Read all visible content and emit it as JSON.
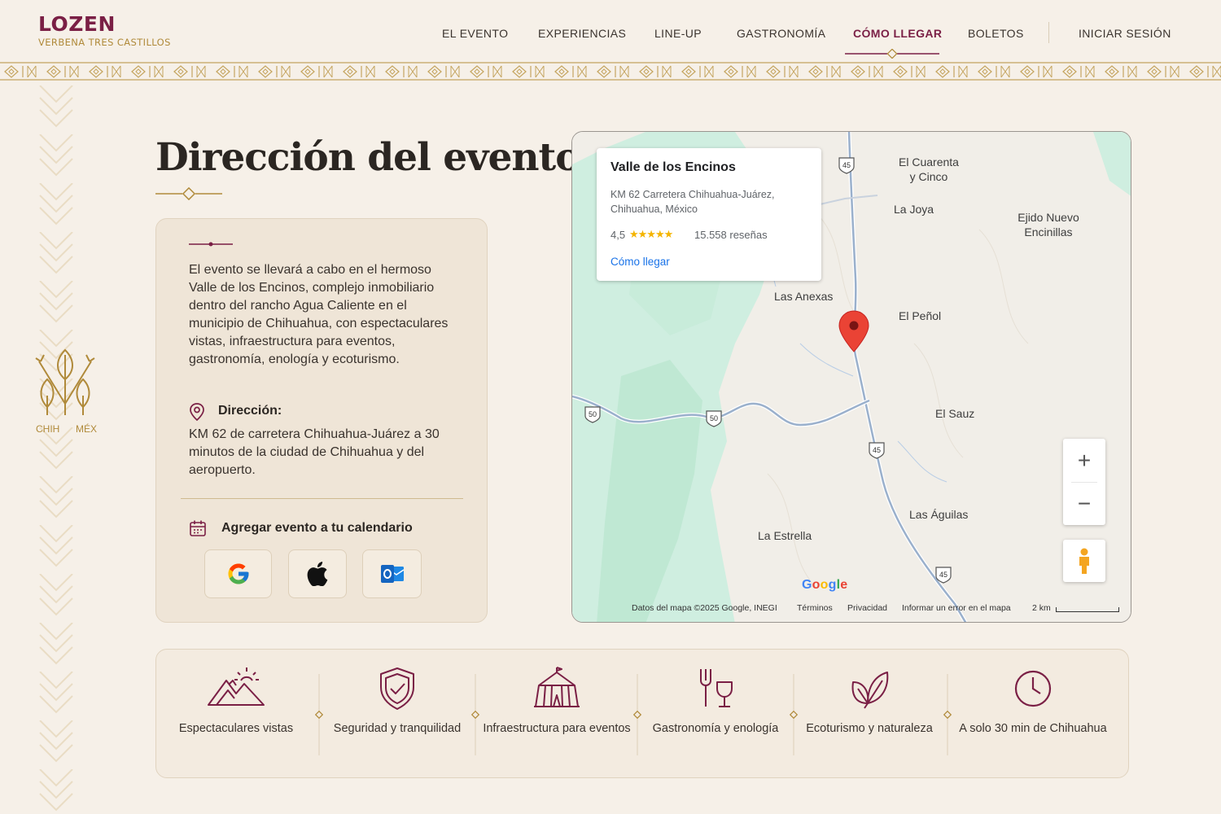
{
  "brand": {
    "name": "LOZEN",
    "tagline": "VERBENA TRES CASTILLOS",
    "primary_color": "#7a1f45",
    "gold_color": "#b08a3a"
  },
  "nav": {
    "items": [
      {
        "label": "EL EVENTO"
      },
      {
        "label": "EXPERIENCIAS"
      },
      {
        "label": "LINE-UP"
      },
      {
        "label": "GASTRONOMÍA"
      },
      {
        "label": "CÓMO LLEGAR",
        "active": true
      },
      {
        "label": "BOLETOS"
      }
    ],
    "login": "INICIAR SESIÓN"
  },
  "emblem": {
    "left": "CHIH",
    "right": "MÉX"
  },
  "page": {
    "title": "Dirección del evento"
  },
  "info": {
    "description": "El evento se llevará a cabo en el hermoso Valle de los Encinos, complejo inmobiliario dentro del rancho Agua Caliente en el municipio de Chihuahua, con espectaculares vistas, infraestructura para eventos, gastronomía, enología y ecoturismo.",
    "address_label": "Dirección:",
    "address_text": "KM 62 de carretera Chihuahua-Juárez a 30 minutos de la ciudad de Chihuahua y del aeropuerto.",
    "calendar_label": "Agregar evento a tu calendario",
    "calendar_buttons": [
      "google-calendar",
      "apple-calendar",
      "outlook-calendar"
    ]
  },
  "map": {
    "place": {
      "name": "Valle de los Encinos",
      "address": "KM 62 Carretera Chihuahua-Juárez, Chihuahua, México",
      "rating": "4,5",
      "stars": "★★★★★",
      "reviews": "15.558 reseñas",
      "directions": "Cómo llegar"
    },
    "labels": {
      "cuarenta": "El Cuarenta y Cinco",
      "joya": "La Joya",
      "ejido": "Ejido Nuevo Encinillas",
      "anexas": "Las Anexas",
      "penol": "El Peñol",
      "sauz": "El Sauz",
      "aguilas": "Las Águilas",
      "estrella": "La Estrella"
    },
    "route_45": "45",
    "route_50": "50",
    "zoom_in": "+",
    "zoom_out": "−",
    "google": "Google",
    "footer": {
      "data": "Datos del mapa ©2025 Google, INEGI",
      "terms": "Términos",
      "privacy": "Privacidad",
      "report": "Informar un error en el mapa",
      "scale": "2 km"
    }
  },
  "features": [
    {
      "label": "Espectaculares vistas",
      "icon": "mountains-icon"
    },
    {
      "label": "Seguridad y tranquilidad",
      "icon": "shield-check-icon"
    },
    {
      "label": "Infraestructura para eventos",
      "icon": "tent-icon"
    },
    {
      "label": "Gastronomía y enología",
      "icon": "fork-wine-icon"
    },
    {
      "label": "Ecoturismo y naturaleza",
      "icon": "leaf-icon"
    },
    {
      "label": "A solo 30 min de Chihuahua",
      "icon": "clock-icon"
    }
  ]
}
